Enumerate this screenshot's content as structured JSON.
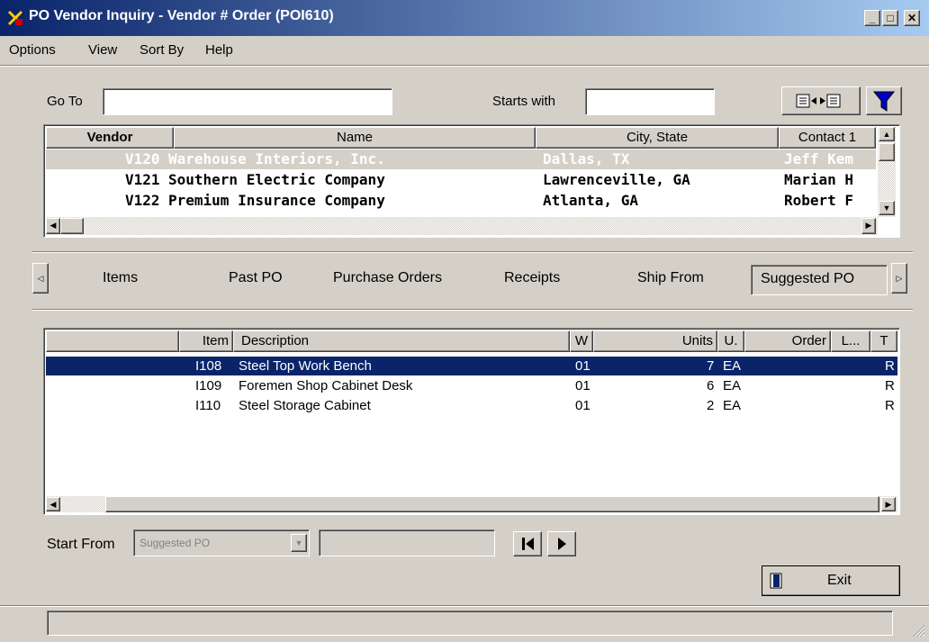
{
  "window": {
    "title": "PO Vendor Inquiry - Vendor # Order (POI610)"
  },
  "menu": [
    {
      "label": "Options"
    },
    {
      "label": "View"
    },
    {
      "label": "Sort By"
    },
    {
      "label": "Help"
    }
  ],
  "search": {
    "goto_label": "Go To",
    "goto_value": "",
    "starts_with_label": "Starts with",
    "starts_with_value": ""
  },
  "vendor_grid": {
    "headers": [
      "Vendor",
      "Name",
      "City, State",
      "Contact 1"
    ],
    "rows": [
      {
        "vendor": "V120",
        "name": "Warehouse Interiors, Inc.",
        "city": "Dallas, TX",
        "contact": "Jeff Kem"
      },
      {
        "vendor": "V121",
        "name": "Southern Electric Company",
        "city": "Lawrenceville, GA",
        "contact": "Marian H"
      },
      {
        "vendor": "V122",
        "name": "Premium Insurance Company",
        "city": "Atlanta, GA",
        "contact": "Robert F"
      }
    ]
  },
  "tabs": [
    "Items",
    "Past PO",
    "Purchase Orders",
    "Receipts",
    "Ship From",
    "Suggested PO"
  ],
  "items_grid": {
    "headers": [
      "Item",
      "Description",
      "W",
      "Units",
      "U.",
      "Order",
      "L...",
      "T"
    ],
    "rows": [
      {
        "item": "I108",
        "description": "Steel Top Work Bench",
        "w": "01",
        "units": "7",
        "u": "EA",
        "t": "R"
      },
      {
        "item": "I109",
        "description": "Foremen Shop Cabinet Desk",
        "w": "01",
        "units": "6",
        "u": "EA",
        "t": "R"
      },
      {
        "item": "I110",
        "description": "Steel Storage Cabinet",
        "w": "01",
        "units": "2",
        "u": "EA",
        "t": "R"
      }
    ]
  },
  "start_from": {
    "label": "Start From",
    "select_value": "Suggested PO",
    "text_value": ""
  },
  "buttons": {
    "exit": "Exit"
  },
  "colors": {
    "title_start": "#0a246a",
    "title_end": "#a6caf0",
    "selection": "#0a246a",
    "face": "#d4d0c8"
  }
}
